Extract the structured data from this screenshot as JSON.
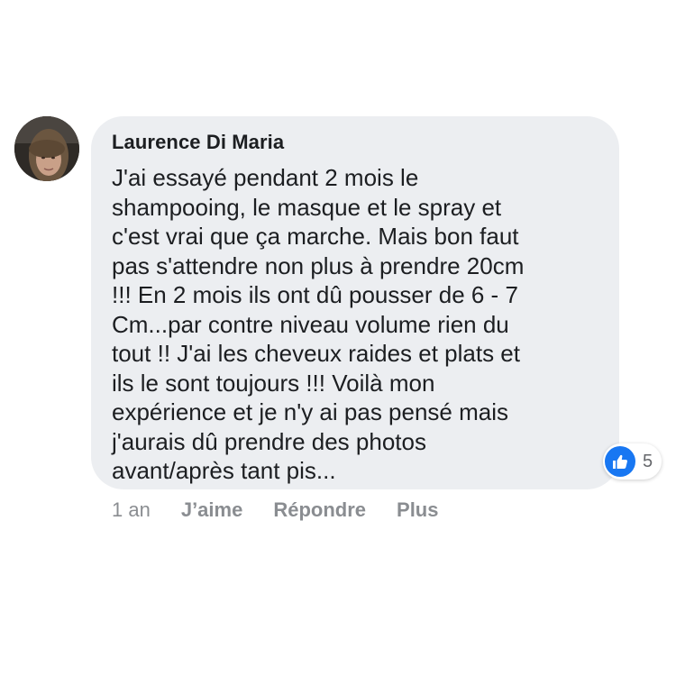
{
  "comment": {
    "author": "Laurence Di Maria",
    "body_lines": [
      "J'ai essayé pendant 2 mois le",
      "shampooing, le masque et le spray et",
      "c'est vrai que ça marche. Mais bon faut",
      "pas s'attendre non plus à prendre 20cm",
      "!!! En 2 mois ils ont dû pousser de 6 - 7",
      "Cm...par contre niveau volume rien du",
      "tout !! J'ai les cheveux raides et plats et",
      "ils le sont toujours !!! Voilà mon",
      "expérience et je n'y ai pas pensé mais",
      "j'aurais dû prendre des photos",
      "avant/après tant pis..."
    ],
    "reactions": {
      "icon": "like-icon",
      "count": "5"
    },
    "timestamp": "1 an",
    "actions": {
      "like": "J’aime",
      "reply": "Répondre",
      "more": "Plus"
    }
  },
  "colors": {
    "bubble_bg": "#eceef1",
    "text": "#1c1e21",
    "meta": "#8a8d91",
    "like_blue": "#1877f2"
  }
}
